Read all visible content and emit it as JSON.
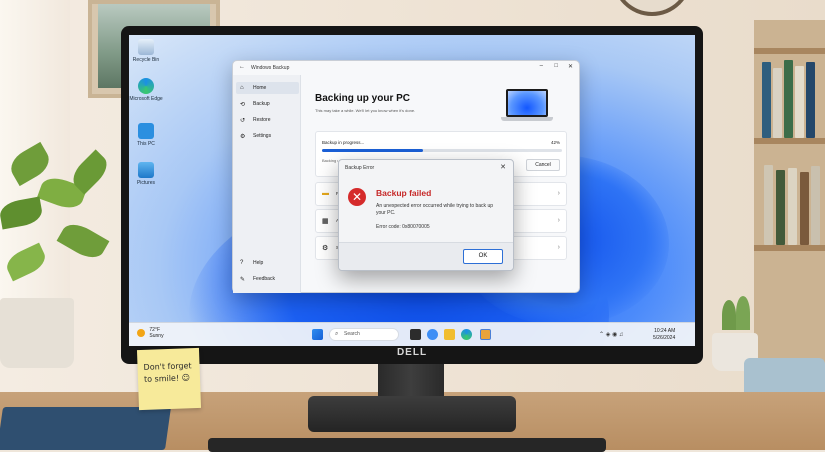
{
  "app": {
    "window_title": "Windows Backup",
    "nav": {
      "home": "Home",
      "backup": "Backup",
      "restore": "Restore",
      "settings": "Settings",
      "help": "Help",
      "feedback": "Feedback"
    },
    "heading": "Backing up your PC",
    "subheading": "This may take a while. We'll let you know when it's done.",
    "progress": {
      "label": "Backup in progress...",
      "percent_text": "42%",
      "value": 0.42,
      "status": "Backing up files..."
    },
    "cancel_label": "Cancel",
    "rows": [
      {
        "icon": "folder-icon",
        "label": "Folders"
      },
      {
        "icon": "apps-icon",
        "label": "Apps"
      },
      {
        "icon": "settings-gear-icon",
        "label": "Settings"
      }
    ]
  },
  "dialog": {
    "title": "Backup Error",
    "heading": "Backup failed",
    "message": "An unexpected error occurred while trying to back up your PC.",
    "error_code": "Error code: 0x80070005",
    "ok_label": "OK"
  },
  "desktop_icons": [
    {
      "label": "Recycle Bin"
    },
    {
      "label": "Microsoft Edge"
    },
    {
      "label": "This PC"
    },
    {
      "label": "Pictures"
    }
  ],
  "taskbar": {
    "weather_temp": "72°F",
    "weather_desc": "Sunny",
    "search_placeholder": "Search",
    "time": "10:24 AM",
    "date": "5/26/2024"
  },
  "monitor_brand": "DELL",
  "sticky_note": "Don't forget to smile! ☺",
  "colors": {
    "accent": "#1a5fd6",
    "error": "#d52b2b",
    "sticky": "#f7ea9a"
  }
}
